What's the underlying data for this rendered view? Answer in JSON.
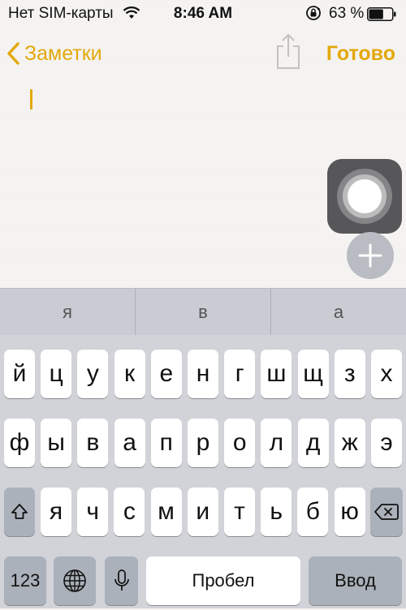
{
  "status_bar": {
    "carrier": "Нет SIM-карты",
    "time": "8:46 AM",
    "battery_percent": "63 %",
    "battery_level": 0.63
  },
  "nav": {
    "back_label": "Заметки",
    "done_label": "Готово",
    "share_icon": "share-icon"
  },
  "colors": {
    "accent": "#e3a80c",
    "keyboard_bg": "#d1d3d9",
    "predict_bg": "#c9ccd3"
  },
  "predictions": [
    "я",
    "в",
    "а"
  ],
  "keyboard": {
    "row1": [
      "й",
      "ц",
      "у",
      "к",
      "е",
      "н",
      "г",
      "ш",
      "щ",
      "з",
      "х"
    ],
    "row2": [
      "ф",
      "ы",
      "в",
      "а",
      "п",
      "р",
      "о",
      "л",
      "д",
      "ж",
      "э"
    ],
    "row3": [
      "я",
      "ч",
      "с",
      "м",
      "и",
      "т",
      "ь",
      "б",
      "ю"
    ],
    "numbers_label": "123",
    "space_label": "Пробел",
    "return_label": "Ввод"
  }
}
